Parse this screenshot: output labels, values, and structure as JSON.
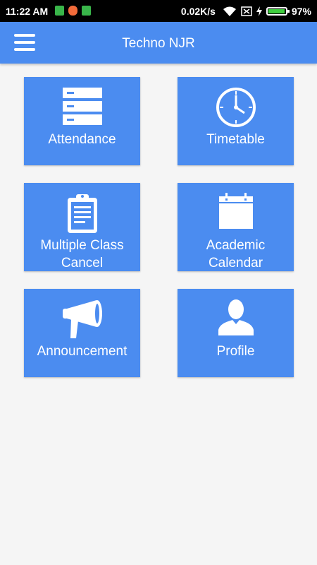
{
  "status_bar": {
    "time": "11:22 AM",
    "net_speed": "0.02K/s",
    "battery_percent_text": "97%",
    "battery_level": 0.97,
    "icons": [
      "notification-green-icon",
      "notification-orange-icon",
      "notification-green-app-icon",
      "wifi-icon",
      "no-sim-icon",
      "charging-icon",
      "battery-icon"
    ]
  },
  "header": {
    "title": "Techno NJR",
    "menu_icon": "hamburger-menu-icon"
  },
  "tiles": [
    {
      "line1": "Attendance",
      "line2": "",
      "icon": "server-stack-icon"
    },
    {
      "line1": "Timetable",
      "line2": "",
      "icon": "clock-icon"
    },
    {
      "line1": "Multiple Class",
      "line2": "Cancel",
      "icon": "clipboard-icon"
    },
    {
      "line1": "Academic",
      "line2": "Calendar",
      "icon": "calendar-icon"
    },
    {
      "line1": "Announcement",
      "line2": "",
      "icon": "megaphone-icon"
    },
    {
      "line1": "Profile",
      "line2": "",
      "icon": "user-icon"
    }
  ],
  "colors": {
    "primary": "#4b8cf0",
    "background": "#f5f5f5",
    "status_bar": "#000000"
  }
}
